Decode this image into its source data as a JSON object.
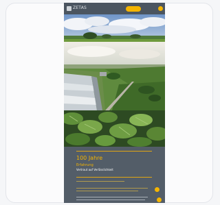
{
  "header": {
    "brand": "ZETAS",
    "cta_label": "",
    "menu_icon": "menu-icon"
  },
  "hero": {
    "images": [
      "sky-field-image",
      "aerial-farm-image",
      "plant-leaves-image"
    ]
  },
  "content": {
    "headline": "100 Jahre",
    "subtitle": "Erfahrung",
    "tagline": "Vertraut auf Verlässlichkeit"
  },
  "colors": {
    "accent": "#f4b400",
    "dark": "#4b5560",
    "content_bg": "#535d68"
  }
}
